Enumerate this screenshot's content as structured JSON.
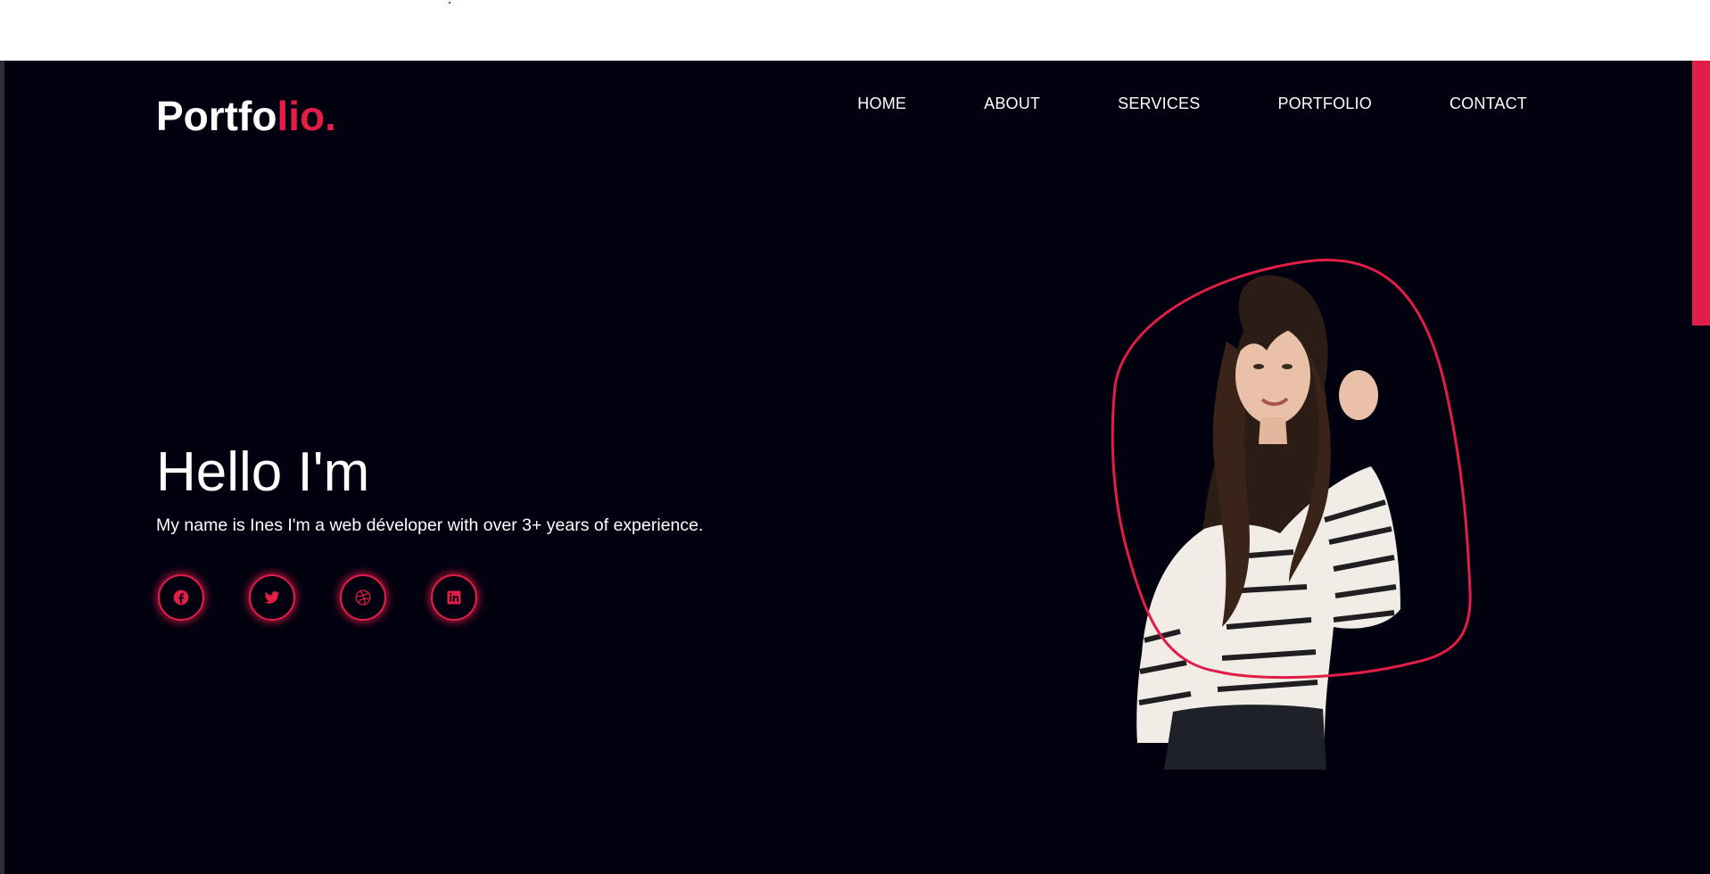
{
  "logo": {
    "main": "Portfo",
    "accent": "lio."
  },
  "nav": {
    "items": [
      "HOME",
      "ABOUT",
      "SERVICES",
      "PORTFOLIO",
      "CONTACT"
    ]
  },
  "hero": {
    "title": "Hello I'm",
    "intro": "My name is Ines I'm a web déveloper with over 3+ years of experience."
  },
  "socials": [
    {
      "icon": "facebook-icon"
    },
    {
      "icon": "twitter-icon"
    },
    {
      "icon": "dribbble-icon"
    },
    {
      "icon": "linkedin-icon"
    }
  ],
  "colors": {
    "accent": "#e11d48",
    "background": "#02010f",
    "text": "#ffffff"
  }
}
